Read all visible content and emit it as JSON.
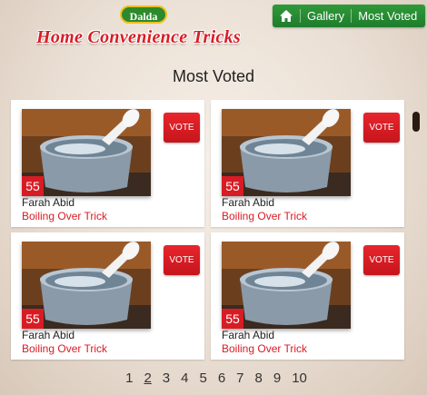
{
  "header": {
    "brand": "Dalda",
    "site_title": "Home Convenience Tricks"
  },
  "nav": {
    "home_icon": "home-icon",
    "links": [
      "Gallery",
      "Most Voted"
    ]
  },
  "page_title": "Most Voted",
  "cards": [
    {
      "votes": "55",
      "vote_label": "VOTE",
      "author": "Farah Abid",
      "trick": "Boiling Over Trick"
    },
    {
      "votes": "55",
      "vote_label": "VOTE",
      "author": "Farah Abid",
      "trick": "Boiling Over Trick"
    },
    {
      "votes": "55",
      "vote_label": "VOTE",
      "author": "Farah Abid",
      "trick": "Boiling Over Trick"
    },
    {
      "votes": "55",
      "vote_label": "VOTE",
      "author": "Farah Abid",
      "trick": "Boiling Over Trick"
    }
  ],
  "pagination": {
    "pages": [
      "1",
      "2",
      "3",
      "4",
      "5",
      "6",
      "7",
      "8",
      "9",
      "10"
    ],
    "current": "2"
  },
  "colors": {
    "accent_red": "#d81c24",
    "nav_green": "#1f7c2c"
  }
}
